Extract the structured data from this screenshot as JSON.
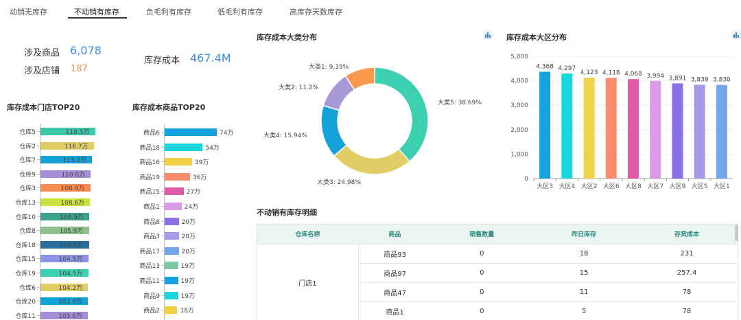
{
  "tabs": [
    {
      "label": "动销无库存",
      "active": false
    },
    {
      "label": "不动销有库存",
      "active": true
    },
    {
      "label": "负毛利有库存",
      "active": false
    },
    {
      "label": "低毛利有库存",
      "active": false
    },
    {
      "label": "高库存天数库存",
      "active": false
    }
  ],
  "kpi": {
    "products_label": "涉及商品",
    "products_value": "6,078",
    "stores_label": "涉及店铺",
    "stores_value": "187",
    "cost_label": "库存成本",
    "cost_value": "467.4M"
  },
  "store_top20": {
    "title": "库存成本门店TOP20",
    "rows": [
      {
        "label": "仓库5",
        "value": 119.5,
        "text": "119.5万",
        "color": "#3cc8a8"
      },
      {
        "label": "仓库2",
        "value": 116.7,
        "text": "116.7万",
        "color": "#e0cd66"
      },
      {
        "label": "仓库7",
        "value": 113.2,
        "text": "113.2万",
        "color": "#10a3d8"
      },
      {
        "label": "仓库9",
        "value": 110.0,
        "text": "110.0万",
        "color": "#a48ed8"
      },
      {
        "label": "仓库3",
        "value": 108.9,
        "text": "108.9万",
        "color": "#f98c4e"
      },
      {
        "label": "仓库13",
        "value": 108.6,
        "text": "108.6万",
        "color": "#cbe041"
      },
      {
        "label": "仓库10",
        "value": 106.9,
        "text": "106.9万",
        "color": "#3aa58c"
      },
      {
        "label": "仓库8",
        "value": 105.9,
        "text": "105.9万",
        "color": "#8fc08e"
      },
      {
        "label": "仓库18",
        "value": 105.8,
        "text": "105.8万",
        "color": "#2a6e9c"
      },
      {
        "label": "仓库15",
        "value": 104.5,
        "text": "104.5万",
        "color": "#8c95e6"
      },
      {
        "label": "仓库19",
        "value": 104.5,
        "text": "104.5万",
        "color": "#3ccfb2"
      },
      {
        "label": "仓库6",
        "value": 104.2,
        "text": "104.2万",
        "color": "#e0cd66"
      },
      {
        "label": "仓库20",
        "value": 103.9,
        "text": "103.9万",
        "color": "#10a3d8"
      },
      {
        "label": "仓库11",
        "value": 103.6,
        "text": "103.6万",
        "color": "#a48ed8"
      }
    ]
  },
  "product_top20": {
    "title": "库存成本商品TOP20",
    "rows": [
      {
        "label": "商品6",
        "value": 74,
        "text": "74万",
        "color": "#14a3de"
      },
      {
        "label": "商品18",
        "value": 54,
        "text": "54万",
        "color": "#18d6dc"
      },
      {
        "label": "商品16",
        "value": 39,
        "text": "39万",
        "color": "#f0cf45"
      },
      {
        "label": "商品19",
        "value": 36,
        "text": "36万",
        "color": "#f98c6e"
      },
      {
        "label": "商品15",
        "value": 27,
        "text": "27万",
        "color": "#e05aa6"
      },
      {
        "label": "商品1",
        "value": 24,
        "text": "24万",
        "color": "#d99ae6"
      },
      {
        "label": "商品8",
        "value": 20,
        "text": "20万",
        "color": "#8a6fe6"
      },
      {
        "label": "商品3",
        "value": 20,
        "text": "20万",
        "color": "#a99ae8"
      },
      {
        "label": "商品17",
        "value": 20,
        "text": "20万",
        "color": "#77a5ec"
      },
      {
        "label": "商品13",
        "value": 19,
        "text": "19万",
        "color": "#7fc9a0"
      },
      {
        "label": "商品11",
        "value": 19,
        "text": "19万",
        "color": "#14a3de"
      },
      {
        "label": "商品9",
        "value": 19,
        "text": "19万",
        "color": "#18d6dc"
      },
      {
        "label": "商品2",
        "value": 18,
        "text": "18万",
        "color": "#f0cf45"
      }
    ]
  },
  "chart_data": [
    {
      "type": "pie",
      "title": "库存成本大类分布",
      "slices": [
        {
          "name": "大类5",
          "value": 38.69,
          "text": "大类5: 38.69%",
          "color": "#3ccfb0"
        },
        {
          "name": "大类3",
          "value": 24.98,
          "text": "大类3: 24.98%",
          "color": "#e0cd66"
        },
        {
          "name": "大类4",
          "value": 15.94,
          "text": "大类4: 15.94%",
          "color": "#14a3d8"
        },
        {
          "name": "大类2",
          "value": 11.2,
          "text": "大类2: 11.2%",
          "color": "#a799d8"
        },
        {
          "name": "大类1",
          "value": 9.19,
          "text": "大类1: 9.19%",
          "color": "#f99a4e"
        }
      ]
    },
    {
      "type": "bar",
      "title": "库存成本大区分布",
      "categories": [
        "大区3",
        "大区4",
        "大区2",
        "大区6",
        "大区8",
        "大区7",
        "大区9",
        "大区5",
        "大区1"
      ],
      "values": [
        4368,
        4297,
        4123,
        4118,
        4068,
        3994,
        3891,
        3839,
        3830
      ],
      "value_labels": [
        "4,368",
        "4,297",
        "4,123",
        "4,118",
        "4,068",
        "3,994",
        "3,891",
        "3,839",
        "3,830"
      ],
      "colors": [
        "#14a3de",
        "#18d6dc",
        "#f0d24a",
        "#f98c6e",
        "#e05aa6",
        "#d99ae6",
        "#8a6fe6",
        "#a99ae8",
        "#77a5ec"
      ],
      "ylim": [
        0,
        5000
      ],
      "yticks": [
        "0",
        "1,000",
        "2,000",
        "3,000",
        "4,000",
        "5,000"
      ]
    }
  ],
  "detail_table": {
    "title": "不动销有库存明细",
    "columns": [
      "仓库名称",
      "商品",
      "销售数量",
      "昨日库存",
      "存货成本"
    ],
    "merged_store": "门店1",
    "rows": [
      {
        "product": "商品93",
        "qty": "0",
        "stock": "18",
        "cost": "231"
      },
      {
        "product": "商品97",
        "qty": "0",
        "stock": "15",
        "cost": "257.4"
      },
      {
        "product": "商品47",
        "qty": "0",
        "stock": "11",
        "cost": "78"
      },
      {
        "product": "商品1",
        "qty": "0",
        "stock": "5",
        "cost": "78"
      }
    ]
  }
}
